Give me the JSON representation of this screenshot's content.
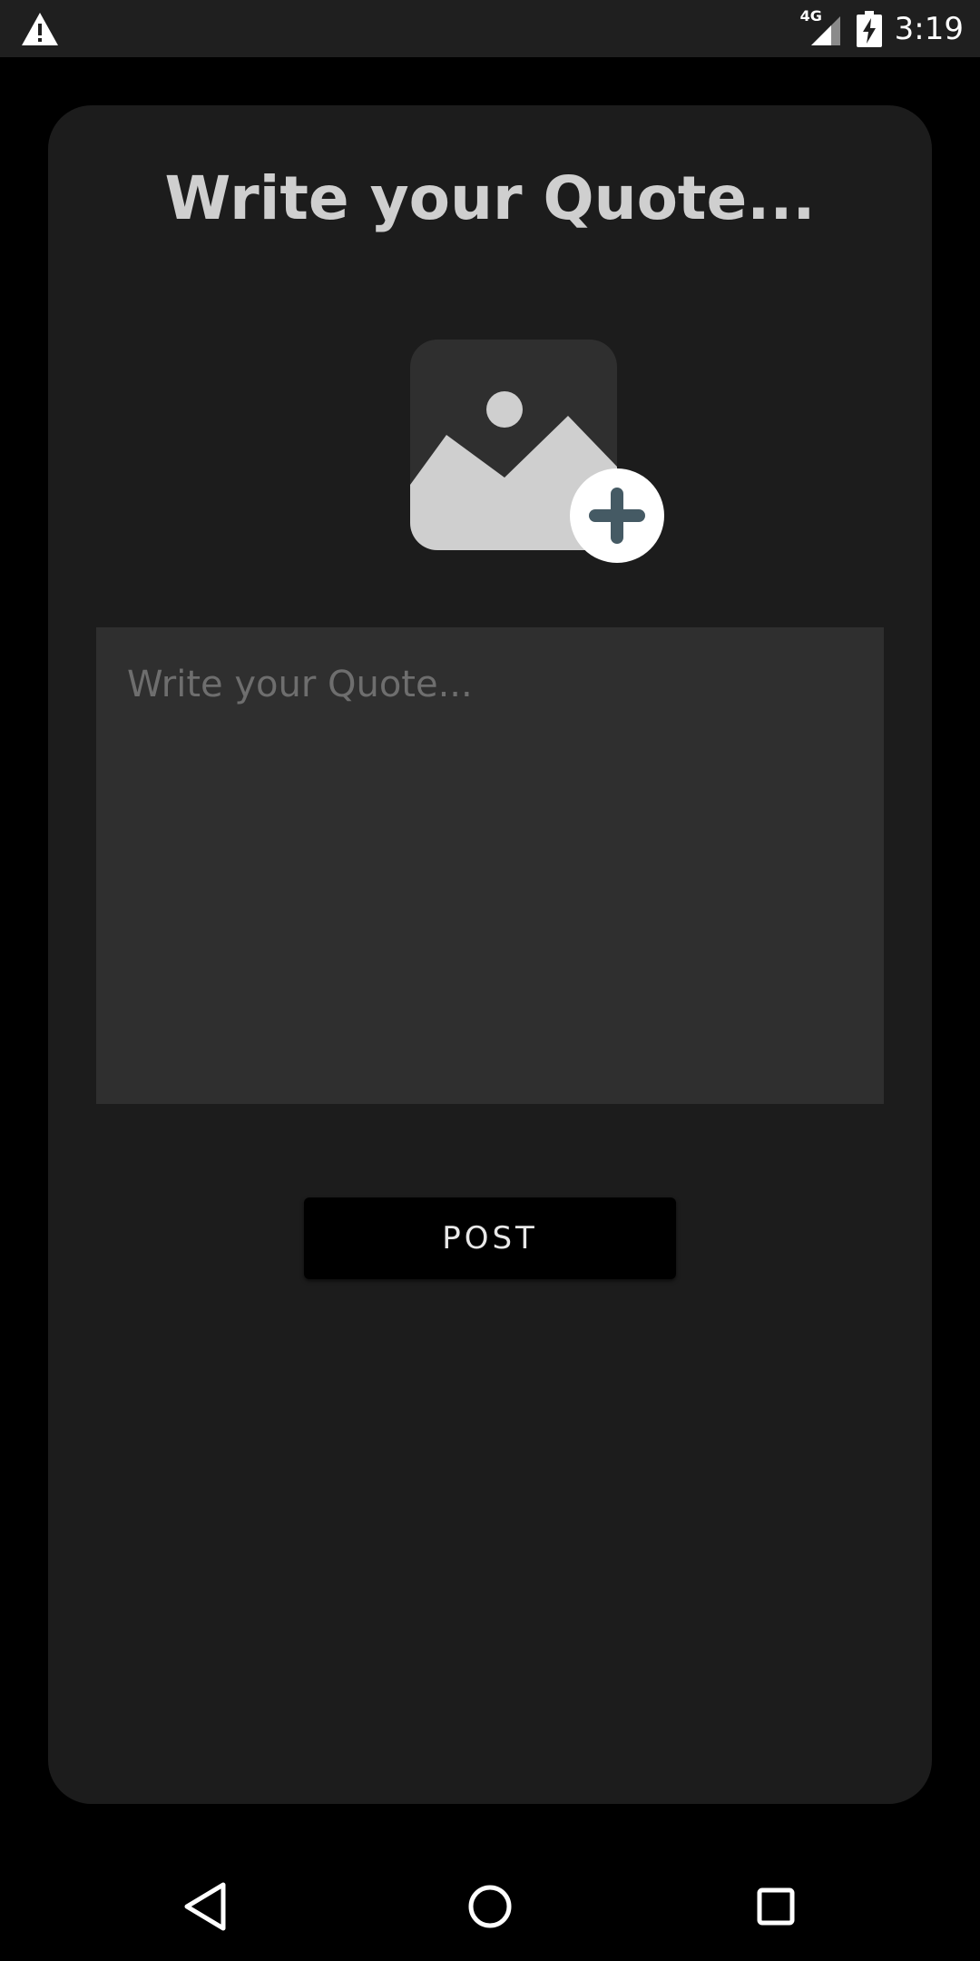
{
  "status_bar": {
    "network_label": "4G",
    "time": "3:19",
    "icons": [
      "warning-icon",
      "signal-icon",
      "battery-charging-icon"
    ]
  },
  "main": {
    "title": "Write your Quote...",
    "image_picker_icon": "image-add-icon",
    "quote_input": {
      "value": "",
      "placeholder": "Write your Quote..."
    },
    "post_button_label": "POST"
  },
  "nav_bar": {
    "icons": [
      "back-icon",
      "home-icon",
      "recents-icon"
    ]
  },
  "colors": {
    "background": "#000000",
    "card": "#1c1c1c",
    "input": "#2f2f2f",
    "title": "#cfcfcf",
    "accent_plus": "#455a64"
  }
}
